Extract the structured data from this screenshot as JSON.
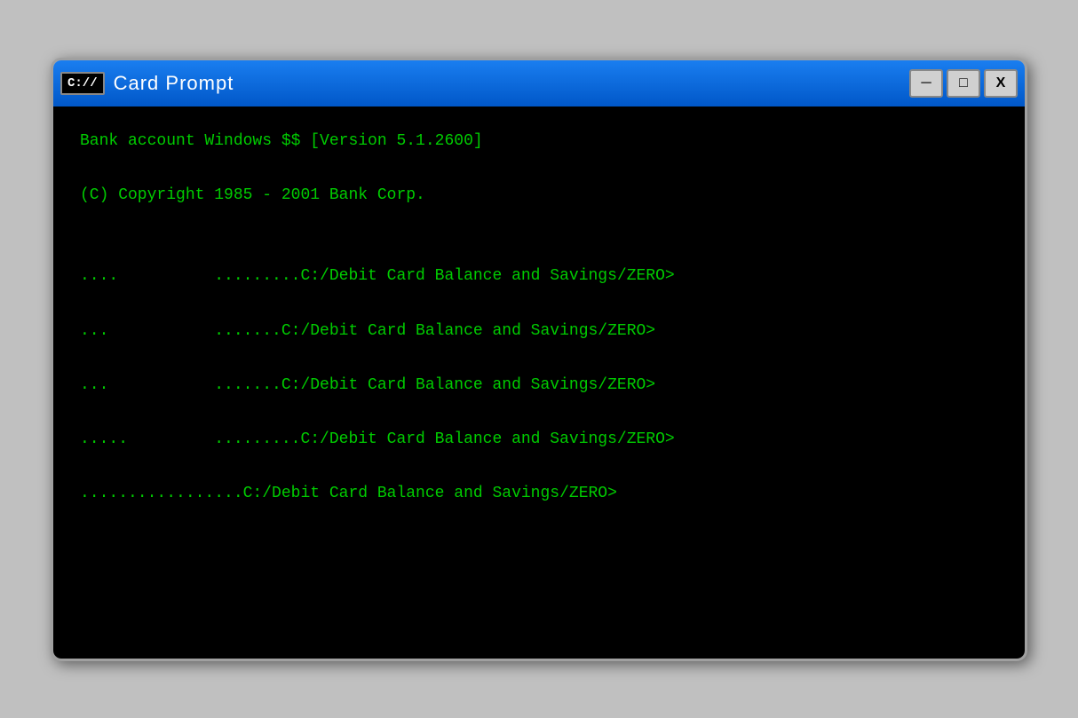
{
  "window": {
    "title": "Card Prompt",
    "icon_label": "C://",
    "controls": {
      "minimize": "─",
      "maximize": "□",
      "close": "X"
    }
  },
  "terminal": {
    "lines": [
      "Bank account Windows $$ [Version 5.1.2600]",
      "(C) Copyright 1985 - 2001 Bank Corp.",
      "",
      "....          .........C:/Debit Card Balance and Savings/ZERO>",
      "...           .......C:/Debit Card Balance and Savings/ZERO>",
      "...           .......C:/Debit Card Balance and Savings/ZERO>",
      ".....         .........C:/Debit Card Balance and Savings/ZERO>",
      ".................C:/Debit Card Balance and Savings/ZERO>"
    ]
  }
}
